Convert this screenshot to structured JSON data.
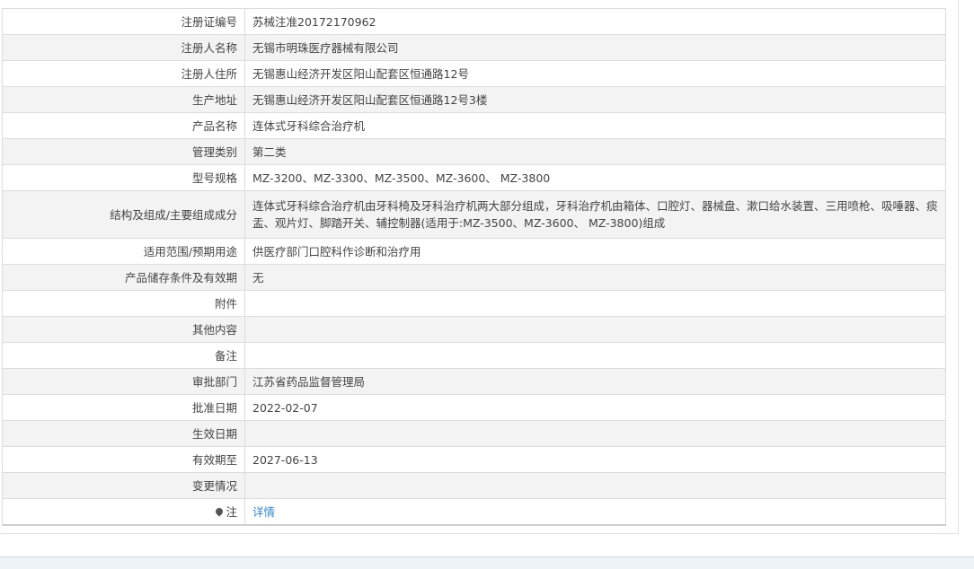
{
  "rows": [
    {
      "label": "注册证编号",
      "value": "苏械注准20172170962"
    },
    {
      "label": "注册人名称",
      "value": "无锡市明珠医疗器械有限公司"
    },
    {
      "label": "注册人住所",
      "value": "无锡惠山经济开发区阳山配套区恒通路12号"
    },
    {
      "label": "生产地址",
      "value": "无锡惠山经济开发区阳山配套区恒通路12号3楼"
    },
    {
      "label": "产品名称",
      "value": "连体式牙科综合治疗机"
    },
    {
      "label": "管理类别",
      "value": "第二类"
    },
    {
      "label": "型号规格",
      "value": "MZ-3200、MZ-3300、MZ-3500、MZ-3600、 MZ-3800"
    },
    {
      "label": "结构及组成/主要组成成分",
      "value": "连体式牙科综合治疗机由牙科椅及牙科治疗机两大部分组成，牙科治疗机由箱体、口腔灯、器械盘、漱口给水装置、三用喷枪、吸唾器、痰盂、观片灯、脚踏开关、辅控制器(适用于:MZ-3500、MZ-3600、 MZ-3800)组成"
    },
    {
      "label": "适用范围/预期用途",
      "value": "供医疗部门口腔科作诊断和治疗用"
    },
    {
      "label": "产品储存条件及有效期",
      "value": "无"
    },
    {
      "label": "附件",
      "value": ""
    },
    {
      "label": "其他内容",
      "value": ""
    },
    {
      "label": "备注",
      "value": ""
    },
    {
      "label": "审批部门",
      "value": "江苏省药品监督管理局"
    },
    {
      "label": "批准日期",
      "value": "2022-02-07"
    },
    {
      "label": "生效日期",
      "value": ""
    },
    {
      "label": "有效期至",
      "value": "2027-06-13"
    },
    {
      "label": "变更情况",
      "value": ""
    }
  ],
  "note": {
    "label": "注",
    "link_text": "详情",
    "icon": "pin-icon"
  }
}
